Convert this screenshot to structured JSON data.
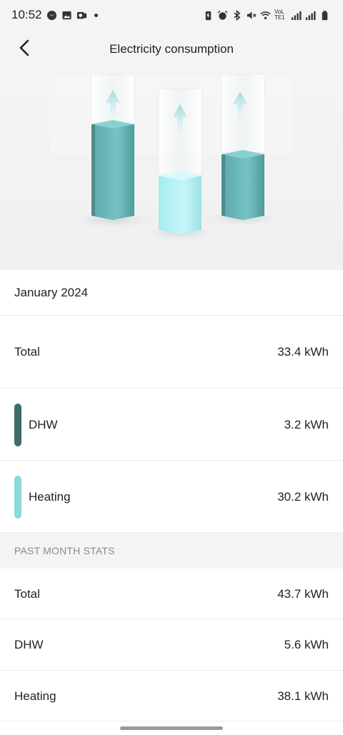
{
  "status_bar": {
    "time": "10:52",
    "left_icons": [
      "messenger-icon",
      "gallery-icon",
      "outlook-icon"
    ],
    "right_icons": [
      "battery-saver-icon",
      "alarm-icon",
      "bluetooth-icon",
      "mute-icon",
      "wifi-icon",
      "signal-icon",
      "signal-icon",
      "battery-icon"
    ],
    "network_label": "VoLTE1"
  },
  "header": {
    "title": "Electricity consumption",
    "back_icon": "chevron-left-icon"
  },
  "colors": {
    "dhw": "#3f6b6b",
    "heating": "#8ad9d9",
    "teal_bar": "#6fbcbe"
  },
  "period": {
    "label": "January 2024"
  },
  "current": {
    "rows": [
      {
        "label": "Total",
        "value": "33.4 kWh"
      },
      {
        "label": "DHW",
        "value": "3.2 kWh",
        "color": "#3f6b6b"
      },
      {
        "label": "Heating",
        "value": "30.2 kWh",
        "color": "#8ad9d9"
      }
    ]
  },
  "past_month": {
    "header": "PAST MONTH STATS",
    "rows": [
      {
        "label": "Total",
        "value": "43.7 kWh"
      },
      {
        "label": "DHW",
        "value": "5.6 kWh"
      },
      {
        "label": "Heating",
        "value": "38.1 kWh"
      }
    ]
  }
}
